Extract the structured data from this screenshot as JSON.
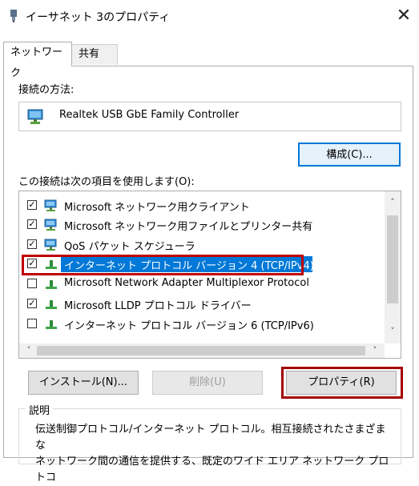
{
  "window": {
    "title": "イーサネット 3のプロパティ",
    "close_glyph": "✕"
  },
  "tabs": [
    {
      "label": "ネットワーク",
      "active": true
    },
    {
      "label": "共有",
      "active": false
    }
  ],
  "connection": {
    "label": "接続の方法:",
    "adapter": "Realtek USB GbE Family Controller",
    "configure_button": "構成(C)..."
  },
  "items_section": {
    "label": "この接続は次の項目を使用します(O):",
    "items": [
      {
        "label": "Microsoft ネットワーク用クライアント",
        "checked": true,
        "icon": "network-client-icon"
      },
      {
        "label": "Microsoft ネットワーク用ファイルとプリンター共有",
        "checked": true,
        "icon": "network-client-icon"
      },
      {
        "label": "QoS パケット スケジューラ",
        "checked": true,
        "icon": "network-client-icon"
      },
      {
        "label": "インターネット プロトコル バージョン 4 (TCP/IPv4)",
        "checked": true,
        "selected": true,
        "icon": "protocol-icon"
      },
      {
        "label": "Microsoft Network Adapter Multiplexor Protocol",
        "checked": false,
        "icon": "protocol-icon"
      },
      {
        "label": "Microsoft LLDP プロトコル ドライバー",
        "checked": true,
        "icon": "protocol-icon"
      },
      {
        "label": "インターネット プロトコル バージョン 6 (TCP/IPv6)",
        "checked": false,
        "icon": "protocol-icon"
      }
    ]
  },
  "buttons": {
    "install": "インストール(N)...",
    "remove": "削除(U)",
    "properties": "プロパティ(R)"
  },
  "description": {
    "legend": "説明",
    "line1": "伝送制御プロトコル/インターネット プロトコル。相互接続されたさまざまな",
    "line2": "ネットワーク間の通信を提供する、既定のワイド エリア ネットワーク プロトコ"
  },
  "colors": {
    "selection": "#0078d7",
    "highlight_box": "#c00000"
  }
}
